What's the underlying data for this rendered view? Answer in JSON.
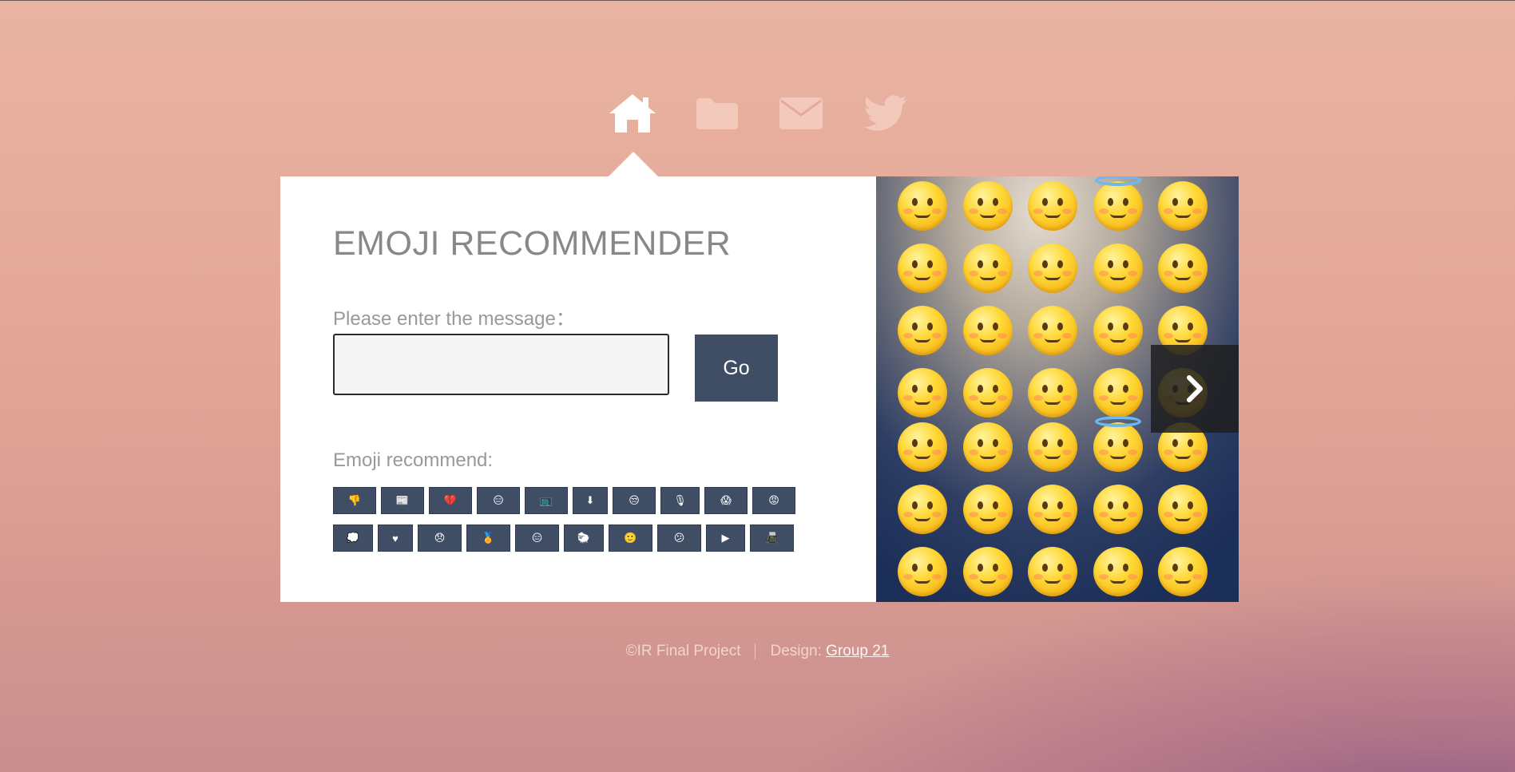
{
  "nav": {
    "items": [
      {
        "name": "home",
        "icon": "home-icon"
      },
      {
        "name": "folder",
        "icon": "folder-icon"
      },
      {
        "name": "mail",
        "icon": "mail-icon"
      },
      {
        "name": "twitter",
        "icon": "twitter-icon"
      }
    ],
    "active": "home"
  },
  "main": {
    "title": "EMOJI RECOMMENDER",
    "prompt": "Please enter the message：",
    "input": {
      "value": "",
      "placeholder": ""
    },
    "go_label": "Go",
    "rec_label": "Emoji recommend:",
    "recommendations_row1": [
      "👎",
      "📰",
      "💔",
      "😑",
      "📺",
      "⬇",
      "😒",
      "🎙",
      "😱",
      "😡"
    ],
    "recommendations_row2": [
      "💭",
      "♥",
      "😞",
      "🏅",
      "😑",
      "🐑",
      "🙂",
      "😕",
      "▶",
      "📠"
    ]
  },
  "carousel": {
    "next_icon": "chevron-right-icon"
  },
  "footer": {
    "copyright": "©IR Final Project",
    "design_label": "Design:",
    "design_link": "Group 21"
  },
  "colors": {
    "button": "#3f4d65",
    "card": "#ffffff",
    "title": "#8a8886"
  }
}
